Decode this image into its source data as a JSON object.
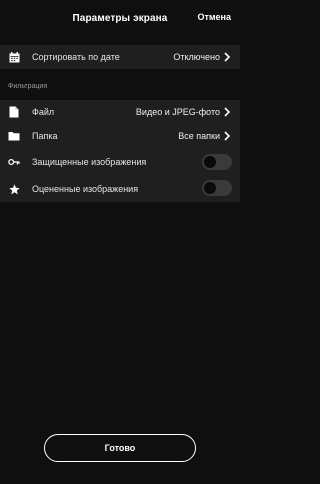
{
  "header": {
    "title": "Параметры экрана",
    "cancel_label": "Отмена"
  },
  "sort": {
    "label": "Сортировать по дате",
    "value": "Отключено"
  },
  "filter_section": {
    "label": "Фильтрация",
    "file": {
      "label": "Файл",
      "value": "Видео и JPEG-фото"
    },
    "folder": {
      "label": "Папка",
      "value": "Все папки"
    },
    "protected": {
      "label": "Защищенные изображения",
      "enabled": false
    },
    "rated": {
      "label": "Оцененные изображения",
      "enabled": false
    }
  },
  "done_label": "Готово",
  "icons": [
    "calendar-icon",
    "file-icon",
    "folder-icon",
    "key-icon",
    "star-icon",
    "chevron-right-icon"
  ],
  "colors": {
    "background": "#0f0f0f",
    "row": "#1f1f1f",
    "toggle_off": "#3a3a3a",
    "text": "#ffffff"
  }
}
